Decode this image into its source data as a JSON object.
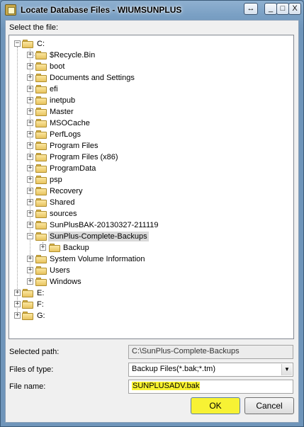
{
  "window": {
    "title": "Locate Database Files - WIUMSUNPLUS",
    "restore_glyph": "↔",
    "min_glyph": "_",
    "max_glyph": "□",
    "close_glyph": "X"
  },
  "select_label": "Select the file:",
  "tree": {
    "root": "C:",
    "items": [
      "$Recycle.Bin",
      "boot",
      "Documents and Settings",
      "efi",
      "inetpub",
      "Master",
      "MSOCache",
      "PerfLogs",
      "Program Files",
      "Program Files (x86)",
      "ProgramData",
      "psp",
      "Recovery",
      "Shared",
      "sources",
      "SunPlusBAK-20130327-211119",
      "SunPlus-Complete-Backups",
      "Backup",
      "System Volume Information",
      "Users",
      "Windows"
    ],
    "drives": [
      "E:",
      "F:",
      "G:"
    ],
    "expanded_glyph": "−",
    "collapsed_glyph": "+"
  },
  "selected_path": {
    "label": "Selected path:",
    "value": "C:\\SunPlus-Complete-Backups"
  },
  "files_of_type": {
    "label": "Files of type:",
    "value": "Backup Files(*.bak;*.tm)",
    "arrow": "▼"
  },
  "file_name": {
    "label": "File name:",
    "value": "SUNPLUSADV.bak"
  },
  "buttons": {
    "ok": "OK",
    "cancel": "Cancel"
  },
  "colors": {
    "highlight": "#f8f230",
    "title_gradient": "#7aa0c4",
    "selected_row": "#d9d9d9"
  }
}
